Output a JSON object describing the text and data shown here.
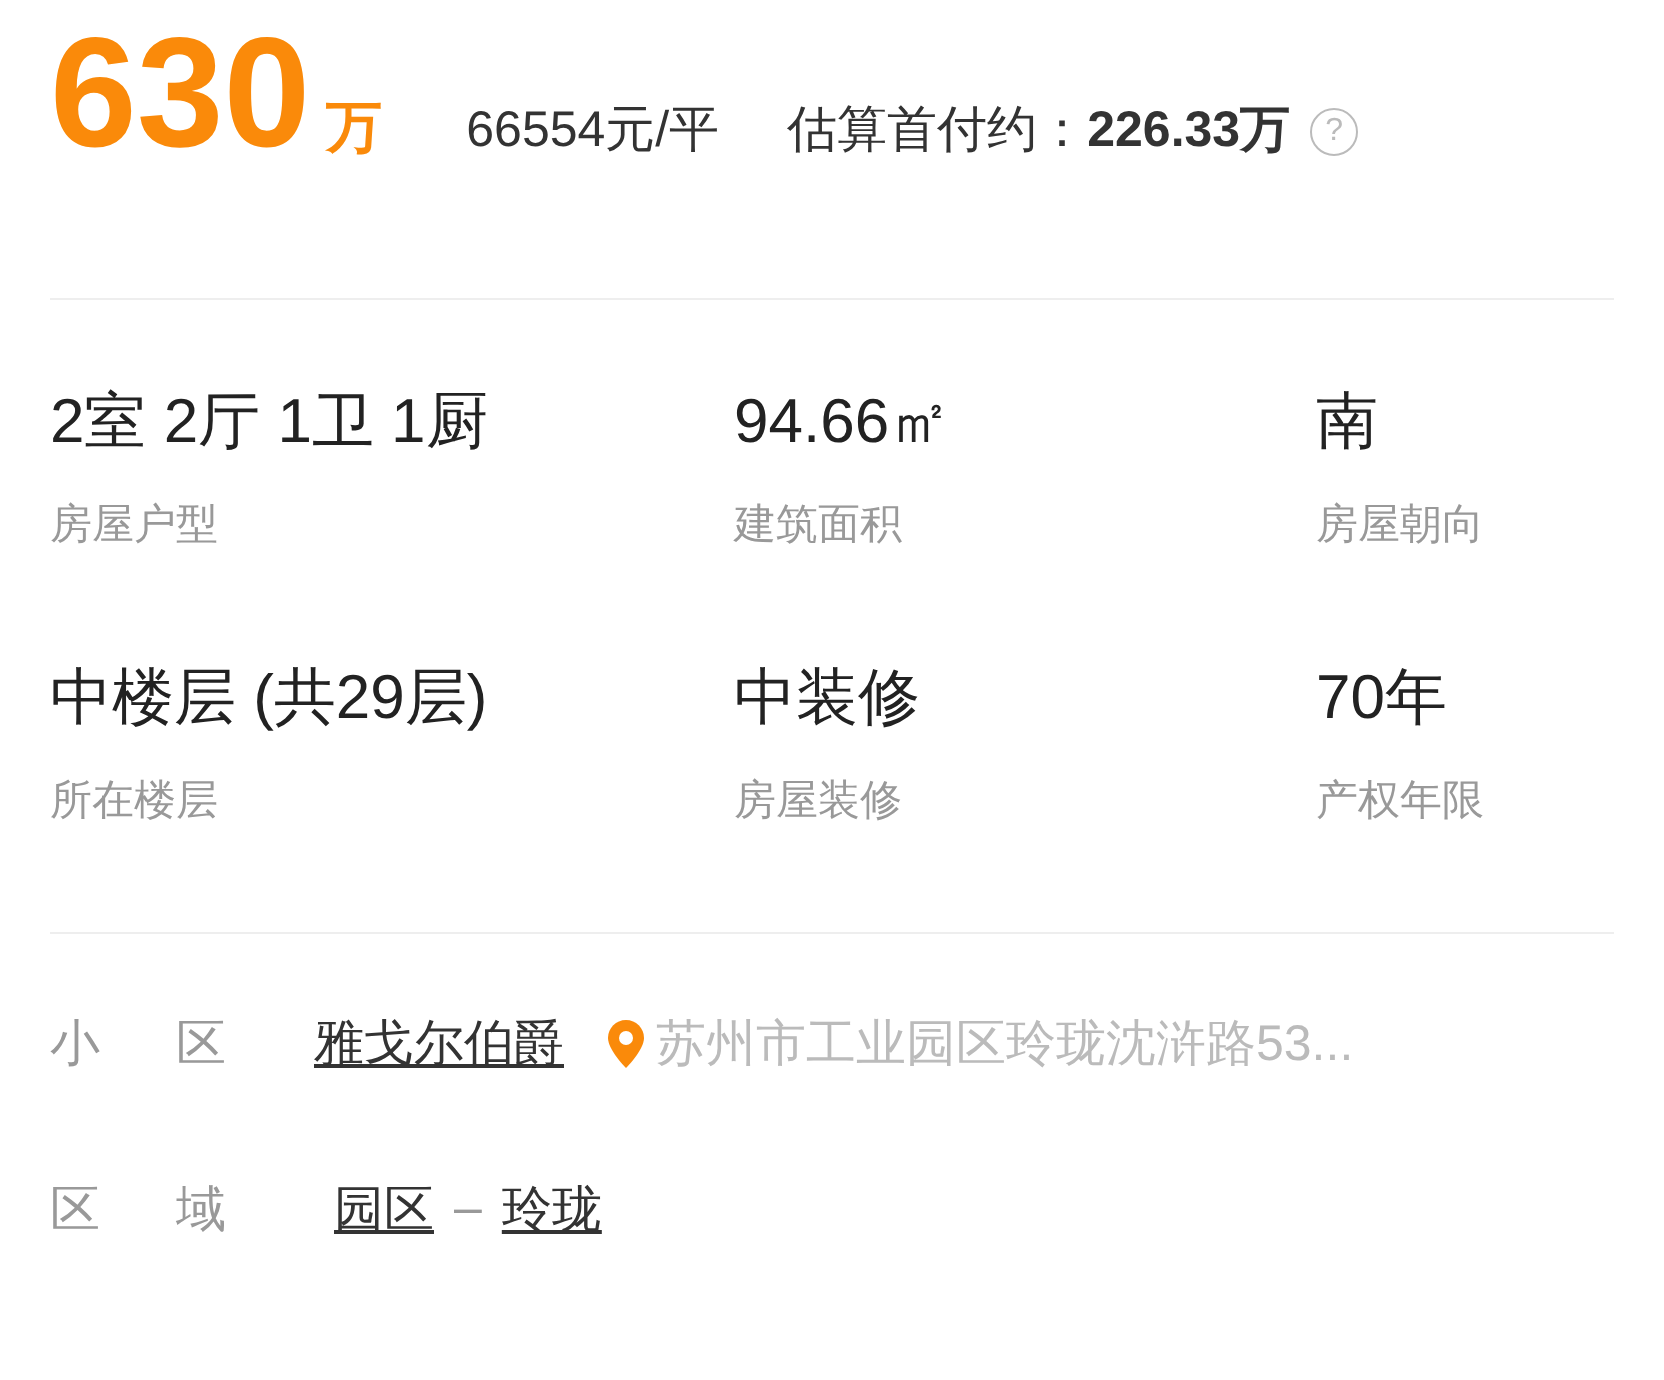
{
  "price": {
    "amount": "630",
    "unit": "万",
    "unit_price": "66554元/平",
    "down_payment_label": "估算首付约：",
    "down_payment": "226.33万",
    "help": "?"
  },
  "specs": [
    {
      "value": "2室 2厅 1卫 1厨",
      "label": "房屋户型"
    },
    {
      "value": "94.66㎡",
      "label": "建筑面积"
    },
    {
      "value": "南",
      "label": "房屋朝向"
    },
    {
      "value": "中楼层 (共29层)",
      "label": "所在楼层"
    },
    {
      "value": "中装修",
      "label": "房屋装修"
    },
    {
      "value": "70年",
      "label": "产权年限"
    }
  ],
  "community": {
    "label": "小区",
    "name": "雅戈尔伯爵",
    "address": "苏州市工业园区玲珑沈浒路53..."
  },
  "district": {
    "label": "区域",
    "area": "园区",
    "separator": "–",
    "subarea": "玲珑"
  }
}
